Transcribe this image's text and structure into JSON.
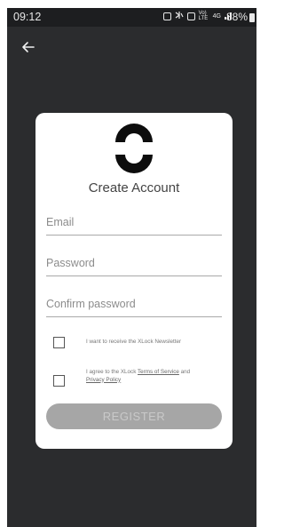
{
  "status_bar": {
    "time": "09:12",
    "icons": [
      "alarm-icon",
      "mute-vibrate-icon",
      "nfc-icon",
      "volte-icon",
      "4g-icon",
      "signal-icon"
    ],
    "volte_text": "Vo) LTE",
    "network_text": "4G",
    "battery_text": "88%"
  },
  "header": {
    "back_icon": "arrow-left-icon"
  },
  "card": {
    "title": "Create Account",
    "fields": {
      "email_placeholder": "Email",
      "password_placeholder": "Password",
      "confirm_placeholder": "Confirm password"
    },
    "newsletter_label": "I want to receive the XLock Newsletter",
    "terms": {
      "prefix": "I agree to the XLock ",
      "terms_link": "Terms of Service",
      "conjunction": " and",
      "privacy_link": "Privacy Policy"
    },
    "register_label": "REGISTER"
  },
  "colors": {
    "background": "#2b2c2e",
    "card": "#ffffff",
    "button_disabled": "#a6a6a6",
    "button_text": "#c9c9c9"
  }
}
